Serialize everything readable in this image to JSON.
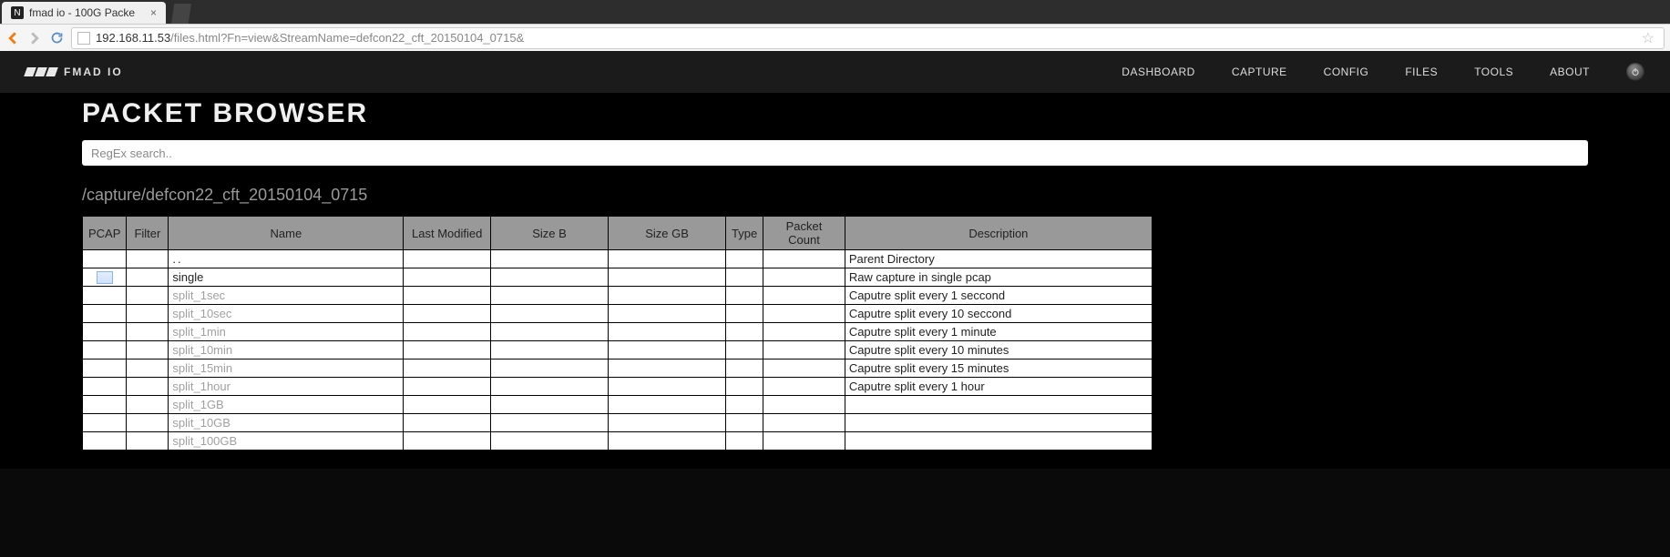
{
  "browser": {
    "tab_title": "fmad io - 100G Packe",
    "favicon_letter": "N",
    "url_host": "192.168.11.53",
    "url_path": "/files.html?Fn=view&StreamName=defcon22_cft_20150104_0715&"
  },
  "header": {
    "brand": "FMAD IO",
    "nav": {
      "dashboard": "DASHBOARD",
      "capture": "CAPTURE",
      "config": "CONFIG",
      "files": "FILES",
      "tools": "TOOLS",
      "about": "ABOUT"
    }
  },
  "page": {
    "title": "PACKET BROWSER",
    "search_placeholder": "RegEx search..",
    "path": "/capture/defcon22_cft_20150104_0715"
  },
  "table": {
    "headers": {
      "pcap": "PCAP",
      "filter": "Filter",
      "name": "Name",
      "modified": "Last Modified",
      "sizeb": "Size B",
      "sizegb": "Size GB",
      "type": "Type",
      "pkt": "Packet Count",
      "desc": "Description"
    },
    "rows": [
      {
        "pcap": false,
        "name": "..",
        "name_style": "parent",
        "desc": "Parent Directory"
      },
      {
        "pcap": true,
        "name": "single",
        "name_style": "link",
        "desc": "Raw capture in single pcap"
      },
      {
        "pcap": false,
        "name": "split_1sec",
        "name_style": "muted",
        "desc": "Caputre split every 1 seccond"
      },
      {
        "pcap": false,
        "name": "split_10sec",
        "name_style": "muted",
        "desc": "Caputre split every 10 seccond"
      },
      {
        "pcap": false,
        "name": "split_1min",
        "name_style": "muted",
        "desc": "Caputre split every 1 minute"
      },
      {
        "pcap": false,
        "name": "split_10min",
        "name_style": "muted",
        "desc": "Caputre split every 10 minutes"
      },
      {
        "pcap": false,
        "name": "split_15min",
        "name_style": "muted",
        "desc": "Caputre split every 15 minutes"
      },
      {
        "pcap": false,
        "name": "split_1hour",
        "name_style": "muted",
        "desc": "Caputre split every 1 hour"
      },
      {
        "pcap": false,
        "name": "split_1GB",
        "name_style": "muted",
        "desc": ""
      },
      {
        "pcap": false,
        "name": "split_10GB",
        "name_style": "muted",
        "desc": ""
      },
      {
        "pcap": false,
        "name": "split_100GB",
        "name_style": "muted",
        "desc": ""
      }
    ]
  }
}
